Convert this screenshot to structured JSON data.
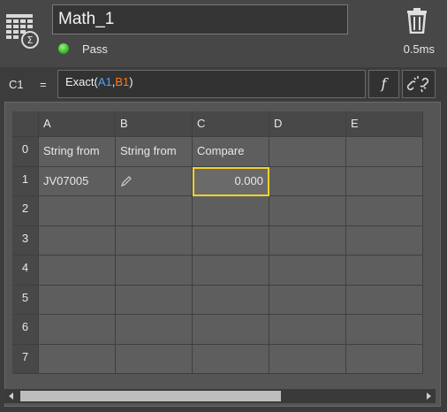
{
  "tool": {
    "name": "Math_1",
    "status": "Pass",
    "time": "0.5ms",
    "status_color": "#3fbf2a"
  },
  "formula": {
    "cell_ref": "C1",
    "equals": "=",
    "func": "Exact(",
    "arg1": "A1",
    "sep": ",",
    "arg2": "B1",
    "close": ")",
    "fx_label": "f"
  },
  "grid": {
    "columns": [
      "A",
      "B",
      "C",
      "D",
      "E"
    ],
    "rows": [
      "0",
      "1",
      "2",
      "3",
      "4",
      "5",
      "6",
      "7"
    ],
    "cells": {
      "A0": "String from",
      "B0": "String from",
      "C0": "Compare",
      "A1": "JV07005",
      "C1": "0.000"
    },
    "icons": {
      "B1": "pencil-icon"
    },
    "selected_cell": "C1"
  },
  "colors": {
    "accent_ref_a": "#4aa3ff",
    "accent_ref_b": "#ff7a1a",
    "selection": "#f2d22a"
  }
}
